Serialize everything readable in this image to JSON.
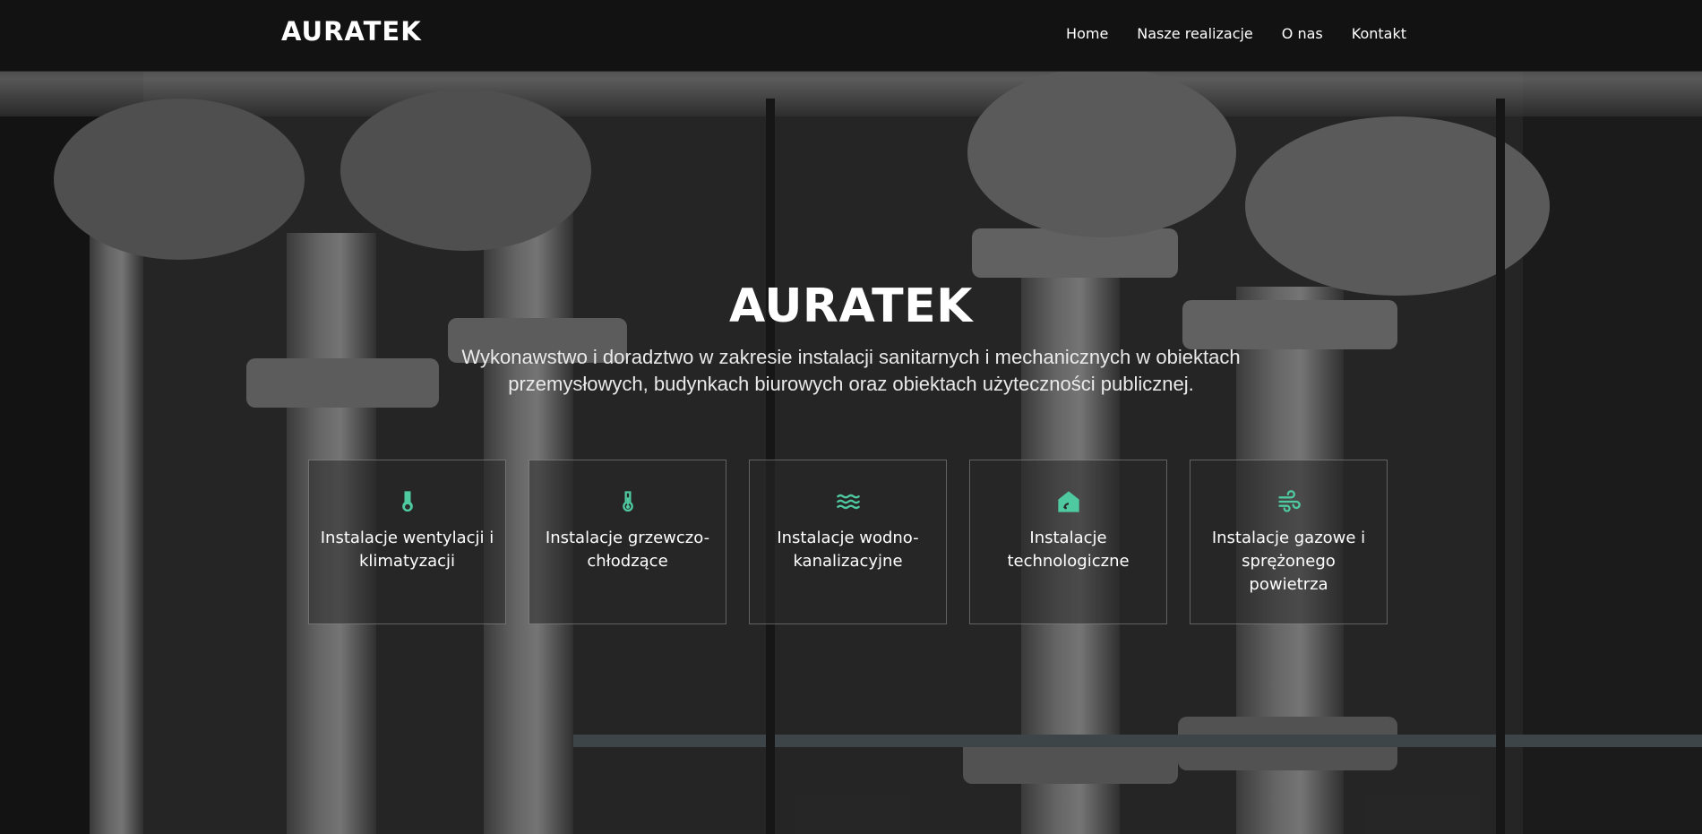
{
  "header": {
    "brand": "AURATEK",
    "nav": [
      {
        "label": "Home"
      },
      {
        "label": "Nasze realizacje"
      },
      {
        "label": "O nas"
      },
      {
        "label": "Kontakt"
      }
    ]
  },
  "hero": {
    "title": "AURATEK",
    "subtitle": "Wykonawstwo i doradztwo w zakresie instalacji sanitarnych i mechanicznych w obiektach przemysłowych, budynkach biurowych oraz obiektach użyteczności publicznej."
  },
  "services": [
    {
      "label": "Instalacje wentylacji i klimatyzacji",
      "icon": "thermometer-drop-icon"
    },
    {
      "label": "Instalacje grzewczo-chłodzące",
      "icon": "thermometer-icon"
    },
    {
      "label": "Instalacje wodno-kanalizacyjne",
      "icon": "water-waves-icon"
    },
    {
      "label": "Instalacje technologiczne",
      "icon": "house-signal-icon"
    },
    {
      "label": "Instalacje gazowe i sprężonego powietrza",
      "icon": "wind-icon"
    }
  ],
  "colors": {
    "accent": "#4fc9a0",
    "navbar": "#121212",
    "text": "#ffffff"
  }
}
